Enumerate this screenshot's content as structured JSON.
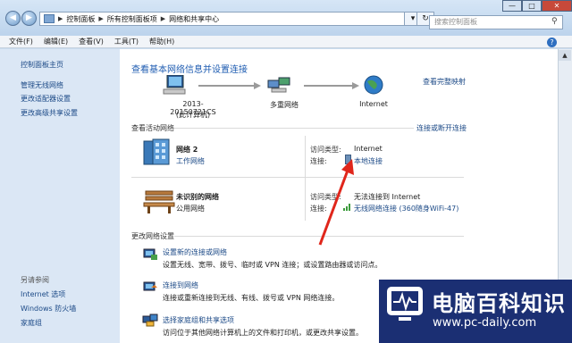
{
  "address": {
    "crumbs": [
      "控制面板",
      "所有控制面板项",
      "网络和共享中心"
    ]
  },
  "search": {
    "placeholder": "搜索控制面板"
  },
  "window_buttons": {
    "minimize": "—",
    "maximize": "□",
    "close": "✕"
  },
  "menu": [
    "文件(F)",
    "编辑(E)",
    "查看(V)",
    "工具(T)",
    "帮助(H)"
  ],
  "sidebar": {
    "home": "控制面板主页",
    "links": [
      "管理无线网络",
      "更改适配器设置",
      "更改高级共享设置"
    ],
    "see_also_title": "另请参阅",
    "see_also": [
      "Internet 选项",
      "Windows 防火墙",
      "家庭组"
    ]
  },
  "main": {
    "title": "查看基本网络信息并设置连接",
    "full_map": "查看完整映射",
    "map": {
      "computer_name": "2013-20150721CS",
      "computer_sub": "(此计算机)",
      "multi_net": "多重网络",
      "internet": "Internet"
    },
    "active_title": "查看活动网络",
    "connect_link": "连接或断开连接",
    "networks": [
      {
        "name": "网络  2",
        "type": "工作网络",
        "access_label": "访问类型:",
        "access_value": "Internet",
        "conn_label": "连接:",
        "conn_value": "本地连接"
      },
      {
        "name": "未识别的网络",
        "type": "公用网络",
        "access_label": "访问类型:",
        "access_value": "无法连接到 Internet",
        "conn_label": "连接:",
        "conn_value": "无线网络连接 (360随身WiFi-47)"
      }
    ],
    "change_title": "更改网络设置",
    "tasks": [
      {
        "title": "设置新的连接或网络",
        "desc": "设置无线、宽带、拨号、临时或 VPN 连接；或设置路由器或访问点。"
      },
      {
        "title": "连接到网络",
        "desc": "连接或重新连接到无线、有线、拨号或 VPN 网络连接。"
      },
      {
        "title": "选择家庭组和共享选项",
        "desc": "访问位于其他网络计算机上的文件和打印机，或更改共享设置。"
      }
    ]
  },
  "watermark": {
    "brand": "电脑百科知识",
    "url": "www.pc-daily.com"
  },
  "colors": {
    "link": "#1c4a87",
    "heading": "#1f5db2",
    "annotation_arrow": "#e0261b",
    "watermark_bg": "#1b2f73"
  }
}
